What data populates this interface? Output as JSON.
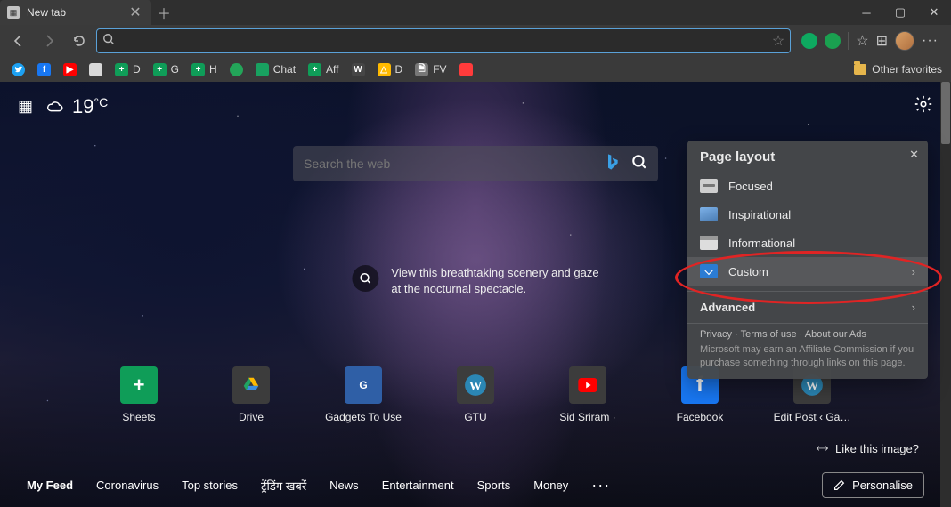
{
  "tab": {
    "title": "New tab"
  },
  "omnibox": {
    "placeholder": ""
  },
  "bookmarks": [
    {
      "label": "",
      "icon": "twitter",
      "color": "#1da1f2",
      "glyph": ""
    },
    {
      "label": "",
      "icon": "facebook",
      "color": "#1877f2",
      "glyph": "f"
    },
    {
      "label": "",
      "icon": "youtube",
      "color": "#ff0000",
      "glyph": "▶"
    },
    {
      "label": "",
      "icon": "sst",
      "color": "#d8d8d8",
      "glyph": ""
    },
    {
      "label": "D",
      "icon": "sheets",
      "color": "#0f9d58",
      "glyph": "+"
    },
    {
      "label": "G",
      "icon": "sheets",
      "color": "#0f9d58",
      "glyph": "+"
    },
    {
      "label": "H",
      "icon": "sheets",
      "color": "#0f9d58",
      "glyph": "+"
    },
    {
      "label": "",
      "icon": "circle",
      "color": "#23a559",
      "glyph": ""
    },
    {
      "label": "Chat",
      "icon": "chat",
      "color": "#18a160",
      "glyph": ""
    },
    {
      "label": "Aff",
      "icon": "sheets",
      "color": "#0f9d58",
      "glyph": "+"
    },
    {
      "label": "",
      "icon": "wordpress",
      "color": "#464646",
      "glyph": "W"
    },
    {
      "label": "D",
      "icon": "drive",
      "color": "#ffba00",
      "glyph": "△"
    },
    {
      "label": "FV",
      "icon": "doc",
      "color": "#777",
      "glyph": "🗎"
    },
    {
      "label": "",
      "icon": "rec",
      "color": "#ff3b3b",
      "glyph": ""
    }
  ],
  "bookmarks_right": "Other favorites",
  "weather": {
    "temp": "19",
    "unit": "°C"
  },
  "ntp_search": {
    "placeholder": "Search the web"
  },
  "caption": {
    "line1": "View this breathtaking scenery and gaze",
    "line2": "at the nocturnal spectacle."
  },
  "quicklinks": [
    {
      "label": "Sheets",
      "bg": "#0f9d58",
      "glyph": "+"
    },
    {
      "label": "Drive",
      "bg": "#3c3c3c",
      "glyph": "drive"
    },
    {
      "label": "Gadgets To Use",
      "bg": "#2f5fa6",
      "glyph": "G"
    },
    {
      "label": "GTU",
      "bg": "#3c3c3c",
      "glyph": "W"
    },
    {
      "label": "Sid Sriram ·",
      "bg": "#3c3c3c",
      "glyph": "yt"
    },
    {
      "label": "Facebook",
      "bg": "#1877f2",
      "glyph": "f"
    },
    {
      "label": "Edit Post ‹ Ga…",
      "bg": "#3c3c3c",
      "glyph": "W2"
    }
  ],
  "like_image": "Like this image?",
  "feed_nav": [
    "My Feed",
    "Coronavirus",
    "Top stories",
    "ट्रेंडिंग खबरें",
    "News",
    "Entertainment",
    "Sports",
    "Money"
  ],
  "personalise": "Personalise",
  "popover": {
    "title": "Page layout",
    "items": [
      {
        "label": "Focused",
        "kind": "focused",
        "selected": false,
        "chevron": false
      },
      {
        "label": "Inspirational",
        "kind": "insp",
        "selected": false,
        "chevron": false
      },
      {
        "label": "Informational",
        "kind": "info",
        "selected": false,
        "chevron": false
      },
      {
        "label": "Custom",
        "kind": "custom",
        "selected": true,
        "chevron": true
      }
    ],
    "advanced": "Advanced",
    "legal_privacy": "Privacy",
    "legal_terms": "Terms of use",
    "legal_ads": "About our Ads",
    "disclaimer": "Microsoft may earn an Affiliate Commission if you purchase something through links on this page."
  }
}
